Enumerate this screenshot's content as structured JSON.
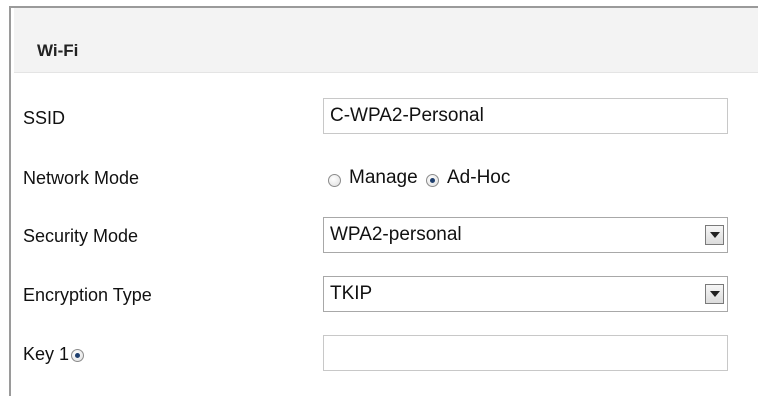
{
  "section": {
    "title": "Wi-Fi"
  },
  "fields": {
    "ssid": {
      "label": "SSID",
      "value": "C-WPA2-Personal"
    },
    "network_mode": {
      "label": "Network Mode",
      "options": [
        {
          "label": "Manage",
          "checked": false
        },
        {
          "label": "Ad-Hoc",
          "checked": true
        }
      ]
    },
    "security_mode": {
      "label": "Security Mode",
      "value": "WPA2-personal"
    },
    "encryption_type": {
      "label": "Encryption Type",
      "value": "TKIP"
    },
    "key1": {
      "label": "Key 1",
      "selected": true,
      "value": ""
    }
  }
}
